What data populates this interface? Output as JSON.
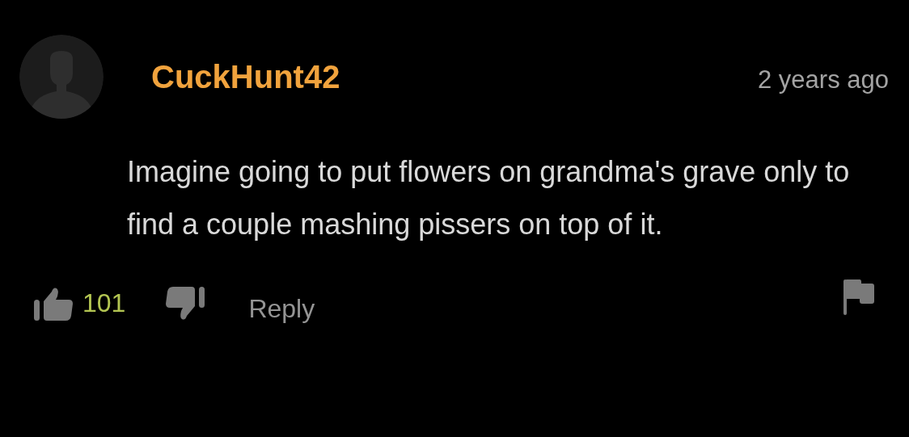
{
  "comment": {
    "username": "CuckHunt42",
    "time": "2 years ago",
    "text": "Imagine going to put flowers on grandma's grave only to find a couple mashing pissers on top of it.",
    "likes": "101",
    "reply": "Reply"
  }
}
